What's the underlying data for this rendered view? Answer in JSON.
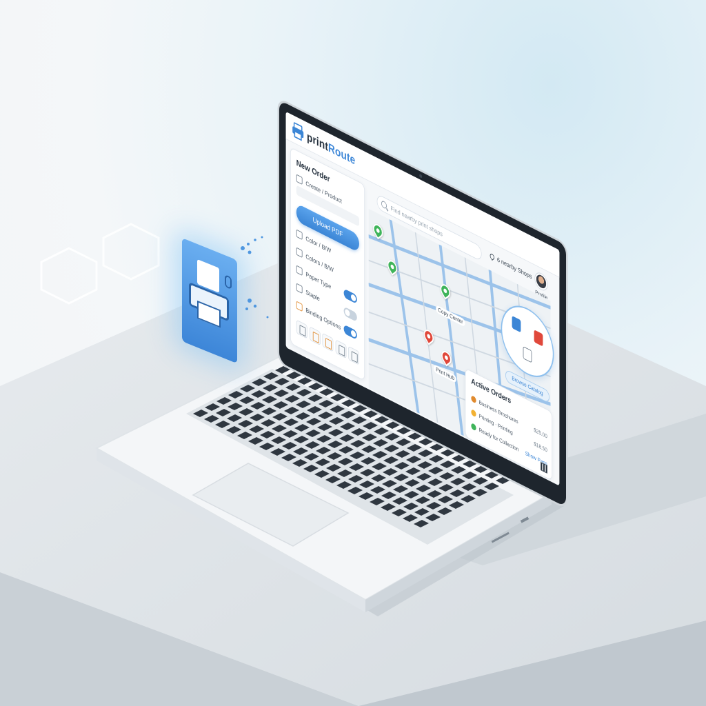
{
  "app": {
    "brand_prefix": "print",
    "brand_suffix": "Route"
  },
  "search": {
    "placeholder": "Find nearby print shops"
  },
  "header": {
    "shop_count": "6 nearby Shops",
    "user_menu": "Profile"
  },
  "new_order": {
    "title": "New Order",
    "items": [
      {
        "label": "Create / Product",
        "icon": "printer-icon"
      },
      {
        "label": "Upload PDF",
        "icon": "upload-icon"
      },
      {
        "label": "Color / B/W",
        "icon": "palette-icon"
      },
      {
        "label": "Colors / B/W",
        "icon": "palette-icon",
        "toggle": true
      },
      {
        "label": "Paper Type",
        "icon": "paper-icon",
        "toggle": true
      },
      {
        "label": "Staple",
        "icon": "staple-icon",
        "toggle": false
      },
      {
        "label": "Binding Options",
        "icon": "binding-icon",
        "toggle": true
      }
    ],
    "upload_label": "Upload PDF"
  },
  "store_bubble": {
    "browse_label": "Browse Catalog"
  },
  "active_orders": {
    "title": "Active Orders",
    "rows": [
      {
        "label": "Business Brochures",
        "value": "$25.00",
        "status_color": "#e08a2e"
      },
      {
        "label": "Printing · Printing",
        "value": "$18.50",
        "status_color": "#f2b132"
      },
      {
        "label": "Ready for Collection",
        "value": "Show Pass",
        "status_color": "#3fb45a"
      }
    ]
  },
  "map": {
    "labels": [
      "Copy Center",
      "Print Hub"
    ]
  },
  "colors": {
    "accent": "#3c86d6",
    "marker_green": "#3fb45a",
    "marker_red": "#e0483b",
    "brand_dark": "#26323f"
  }
}
